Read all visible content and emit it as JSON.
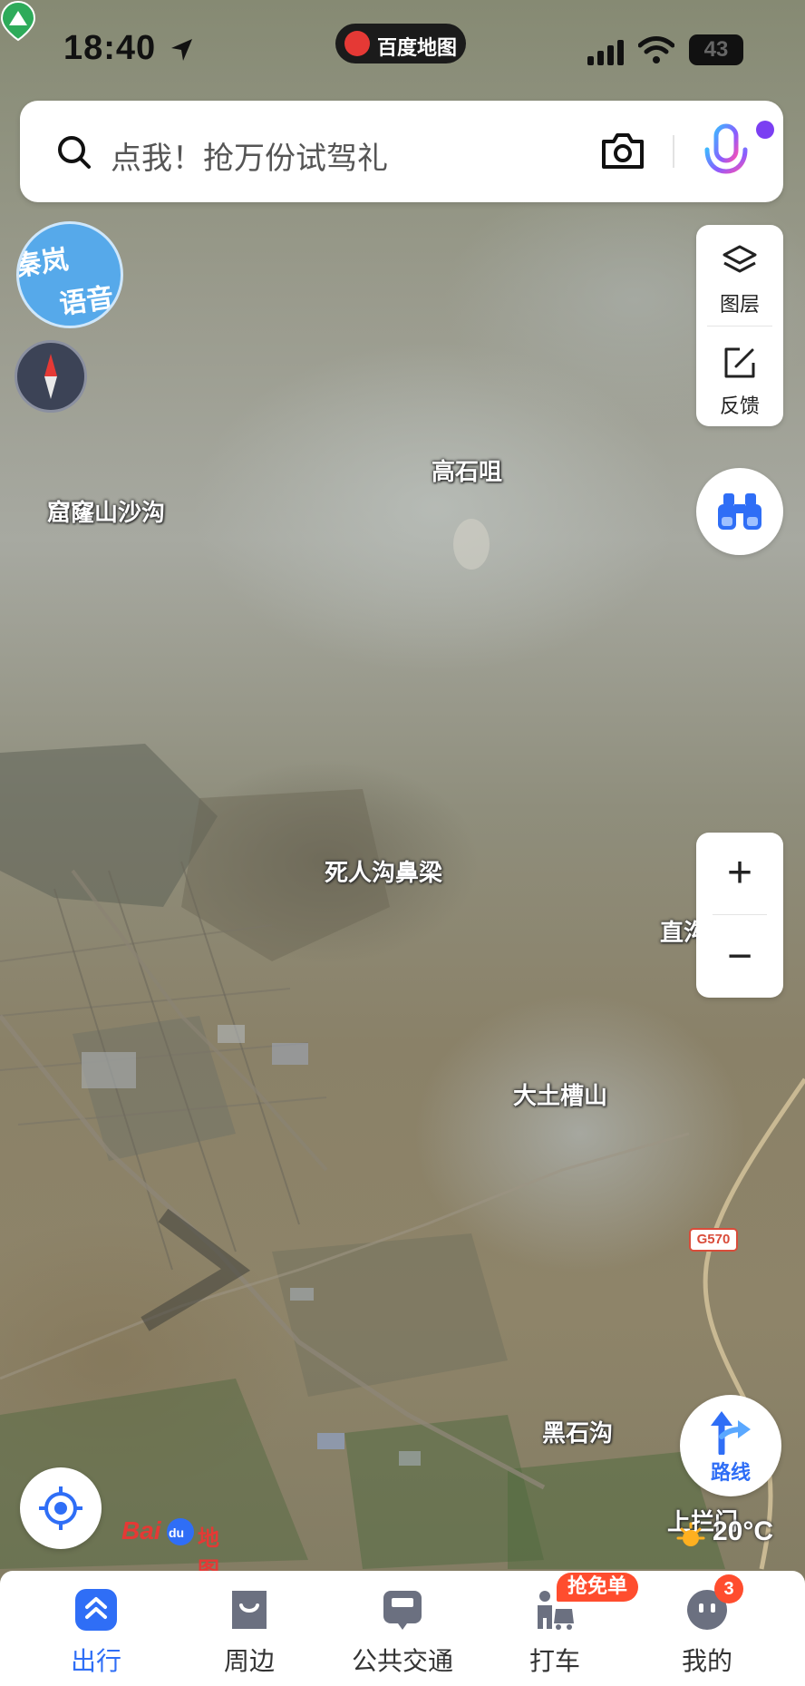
{
  "status_bar": {
    "time": "18:40",
    "app_name": "百度地图",
    "battery": "43"
  },
  "search": {
    "placeholder": "点我！抢万份试驾礼"
  },
  "voice_bubble": {
    "line1": "秦岚",
    "line2": "语音"
  },
  "right_panel": {
    "layers_label": "图层",
    "feedback_label": "反馈"
  },
  "zoom": {
    "in_label": "+",
    "out_label": "−"
  },
  "map_labels": {
    "gaoshiju": "高石咀",
    "kulongshan": "窟窿山沙沟",
    "sirengou": "死人沟鼻梁",
    "zhi": "直沟",
    "datucaoshan": "大土槽山",
    "heishigou": "黑石沟",
    "shangpanmen": "上拦门"
  },
  "road_badge": "G570",
  "route_button": {
    "label": "路线"
  },
  "logo": {
    "bai": "Bai",
    "du": "du",
    "ditu": "地图"
  },
  "weather": {
    "temperature": "20°C"
  },
  "bottom_nav": {
    "items": [
      {
        "label": "出行",
        "active": true
      },
      {
        "label": "周边",
        "active": false
      },
      {
        "label": "公共交通",
        "active": false
      },
      {
        "label": "打车",
        "active": false
      },
      {
        "label": "我的",
        "active": false
      }
    ],
    "taxi_promo": "抢免单",
    "profile_badge": "3"
  },
  "colors": {
    "accent": "#2f6ef6",
    "badge": "#ff4d2e",
    "brand_red": "#e53935"
  }
}
